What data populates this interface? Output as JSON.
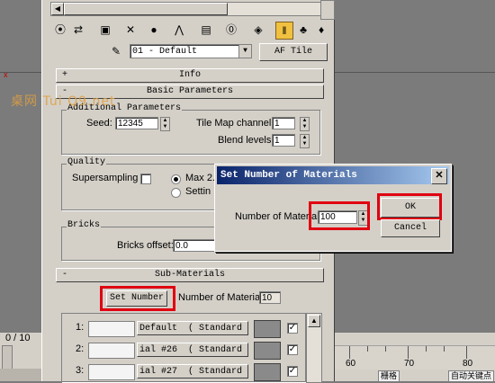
{
  "background": {
    "axis_label": "x",
    "watermark": "桌网 Tui Q9.net",
    "frame_counter": "0 / 10",
    "ruler_labels": [
      "60",
      "70",
      "80"
    ],
    "bottom_keys": [
      "栅格",
      "自动关键点"
    ]
  },
  "toolbar": {
    "icons": [
      "get-material-icon",
      "put-to-scene-icon",
      "assign-material-icon",
      "reset-icon",
      "make-copy-icon",
      "unique-icon",
      "put-to-library-icon",
      "material-effects-icon",
      "show-map-icon",
      "show-end-result-icon",
      "go-to-parent-icon",
      "go-forward-icon"
    ]
  },
  "material": {
    "name": "01 - Default",
    "type_button": "AF Tile"
  },
  "rollouts": {
    "info": "Info",
    "basic": "Basic Parameters",
    "sub": "Sub-Materials"
  },
  "additional": {
    "title": "Additional Parameters",
    "seed_label": "Seed:",
    "seed": "12345",
    "tilemap_label": "Tile Map channel:",
    "tilemap": "1",
    "blend_label": "Blend levels:",
    "blend": "1"
  },
  "quality": {
    "title": "Quality",
    "supersampling_label": "Supersampling",
    "max_label": "Max 2.",
    "setting_label": "Settin"
  },
  "bricks": {
    "title": "Bricks",
    "offset_label": "Bricks offset:",
    "offset": "0.0"
  },
  "submaterials": {
    "set_number": "Set Number",
    "count_label": "Number of Materials:",
    "count": "10",
    "slots": [
      {
        "num": "1:",
        "name": "Default",
        "type": "( Standard )"
      },
      {
        "num": "2:",
        "name": "ial #26",
        "type": "( Standard )"
      },
      {
        "num": "3:",
        "name": "ial #27",
        "type": "( Standard )"
      }
    ]
  },
  "dialog": {
    "title": "Set Number of Materials",
    "close": "✕",
    "field_label": "Number of Materials:",
    "value": "100",
    "ok": "OK",
    "cancel": "Cancel"
  },
  "colors": {
    "highlight": "#e00010",
    "title_bar": "#0a246a",
    "panel": "#d4d0c8"
  }
}
